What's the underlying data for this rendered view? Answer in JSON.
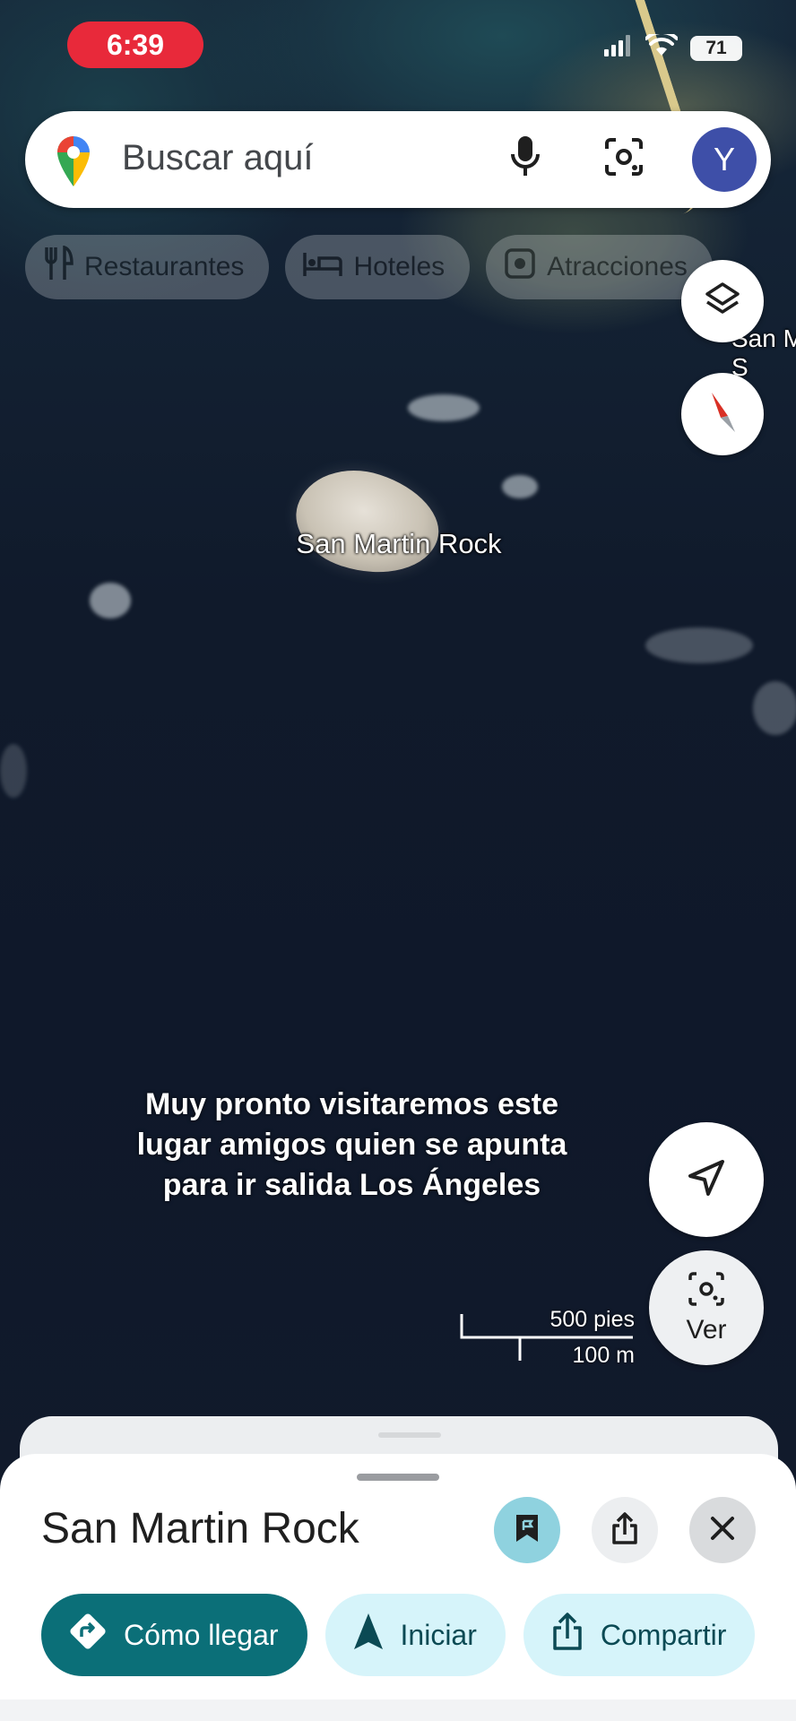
{
  "status_bar": {
    "time": "6:39",
    "battery": "71"
  },
  "search": {
    "placeholder": "Buscar aquí",
    "avatar_letter": "Y"
  },
  "chips": [
    {
      "label": "Restaurantes",
      "icon": "fork-knife-icon"
    },
    {
      "label": "Hoteles",
      "icon": "bed-icon"
    },
    {
      "label": "Atracciones",
      "icon": "attraction-icon"
    }
  ],
  "map": {
    "place_label": "San Martin Rock",
    "edge_label": "San M\nS",
    "caption": "Muy pronto visitaremos este lugar amigos quien se apunta para ir salida Los Ángeles",
    "scale_imperial": "500 pies",
    "scale_metric": "100 m",
    "ver_label": "Ver"
  },
  "sheet": {
    "title": "San Martin Rock",
    "actions": [
      {
        "label": "Cómo llegar",
        "icon": "directions-icon"
      },
      {
        "label": "Iniciar",
        "icon": "navigation-arrow-icon"
      },
      {
        "label": "Compartir",
        "icon": "share-icon"
      }
    ]
  },
  "colors": {
    "accent": "#0b6f78",
    "accent_light": "#d6f4fa",
    "time_pill": "#e8293a",
    "avatar": "#3e4fa8"
  }
}
